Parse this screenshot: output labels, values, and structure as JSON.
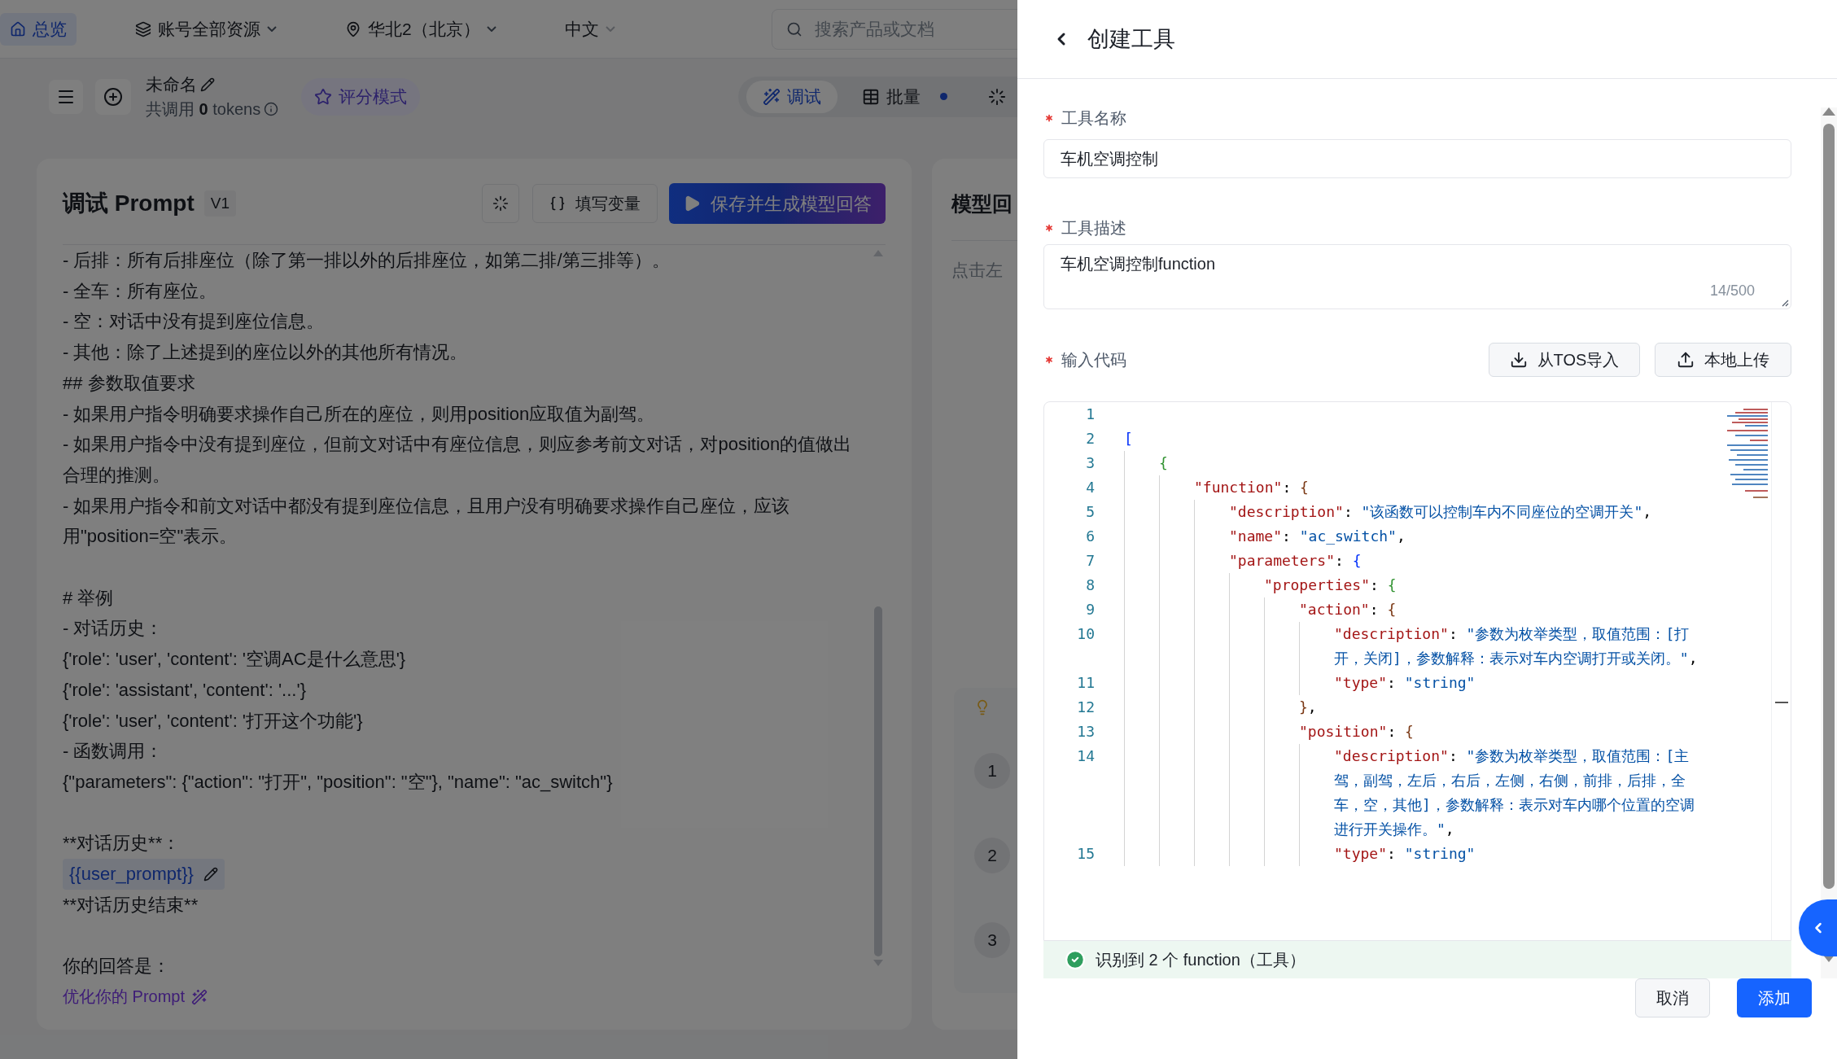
{
  "top_nav": {
    "items": [
      {
        "kind": "home",
        "label": "总览",
        "selected": true
      },
      {
        "kind": "layers",
        "label": "账号全部资源",
        "selected": false
      },
      {
        "kind": "location",
        "label": "华北2（北京）",
        "selected": false
      },
      {
        "kind": "language",
        "label": "中文",
        "selected": false
      }
    ],
    "search": {
      "placeholder": "搜索产品或文档"
    }
  },
  "toolbar": {
    "project_name": "未命名",
    "usage_label": "共调用",
    "usage_value": "0",
    "usage_unit": "tokens",
    "mode_button": "评分模式",
    "view_tabs": [
      {
        "kind": "debug",
        "label": "调试",
        "selected": true,
        "badge": false
      },
      {
        "kind": "batch",
        "label": "批量",
        "selected": false,
        "badge": true
      },
      {
        "kind": "sparkle",
        "selected": false,
        "badge": false
      }
    ]
  },
  "prompt_panel": {
    "title": "调试 Prompt",
    "version": "V1",
    "fill_variables_button": "填写变量",
    "run_button": "保存并生成模型回答",
    "lines": [
      {
        "kind": "text",
        "text": "- 后排：所有后排座位（除了第一排以外的后排座位，如第二排/第三排等）。"
      },
      {
        "kind": "text",
        "text": "- 全车：所有座位。"
      },
      {
        "kind": "text",
        "text": "- 空：对话中没有提到座位信息。"
      },
      {
        "kind": "text",
        "text": "- 其他：除了上述提到的座位以外的其他所有情况。"
      },
      {
        "kind": "text",
        "text": "## 参数取值要求"
      },
      {
        "kind": "text",
        "text": "- 如果用户指令明确要求操作自己所在的座位，则用position应取值为副驾。"
      },
      {
        "kind": "text",
        "text": "- 如果用户指令中没有提到座位，但前文对话中有座位信息，则应参考前文对话，对position的值做出合理的推测。"
      },
      {
        "kind": "text",
        "text": "- 如果用户指令和前文对话中都没有提到座位信息，且用户没有明确要求操作自己座位，应该用\"position=空\"表示。"
      },
      {
        "kind": "gap"
      },
      {
        "kind": "text",
        "text": "# 举例"
      },
      {
        "kind": "text",
        "text": "- 对话历史："
      },
      {
        "kind": "text",
        "text": "{'role': 'user', 'content': '空调AC是什么意思'}"
      },
      {
        "kind": "text",
        "text": "{'role': 'assistant', 'content': '...'}"
      },
      {
        "kind": "text",
        "text": "{'role': 'user', 'content': '打开这个功能'}"
      },
      {
        "kind": "text",
        "text": "- 函数调用："
      },
      {
        "kind": "text",
        "text": "{\"parameters\": {\"action\": \"打开\", \"position\": \"空\"}, \"name\": \"ac_switch\"}"
      },
      {
        "kind": "gap"
      },
      {
        "kind": "text",
        "text": "**对话历史**："
      },
      {
        "kind": "variable",
        "text": "{{user_prompt}}"
      },
      {
        "kind": "text",
        "text": "**对话历史结束**"
      },
      {
        "kind": "gap"
      },
      {
        "kind": "text",
        "text": "你的回答是："
      }
    ],
    "optimize_link": "优化你的 Prompt"
  },
  "result_panel": {
    "title": "模型回",
    "hint": "点击左",
    "steps": [
      "1",
      "2",
      "3"
    ]
  },
  "drawer": {
    "title": "创建工具",
    "name_field": {
      "label": "工具名称",
      "required": true,
      "value": "车机空调控制"
    },
    "description_field": {
      "label": "工具描述",
      "required": true,
      "value": "车机空调控制function",
      "counter": "14/500"
    },
    "code_field": {
      "label": "输入代码",
      "required": true,
      "buttons": [
        {
          "kind": "download",
          "label": "从TOS导入"
        },
        {
          "kind": "upload",
          "label": "本地上传"
        }
      ],
      "lines": [
        {
          "number": "1"
        },
        {
          "number": "2",
          "tokens": [
            {
              "kind": "bracket1",
              "text": "["
            }
          ]
        },
        {
          "number": "3",
          "tokens": [
            {
              "kind": "bracket2",
              "text": "    {"
            }
          ]
        },
        {
          "number": "4",
          "tokens": [
            {
              "kind": "key",
              "text": "        \"function\""
            },
            {
              "kind": "punct",
              "text": ": "
            },
            {
              "kind": "bracket3",
              "text": "{"
            }
          ]
        },
        {
          "number": "5",
          "tokens": [
            {
              "kind": "key",
              "text": "            \"description\""
            },
            {
              "kind": "punct",
              "text": ": "
            },
            {
              "kind": "string",
              "text": "\"该函数可以控制车内不同座位的空调开关\""
            },
            {
              "kind": "punct",
              "text": ","
            }
          ]
        },
        {
          "number": "6",
          "tokens": [
            {
              "kind": "key",
              "text": "            \"name\""
            },
            {
              "kind": "punct",
              "text": ": "
            },
            {
              "kind": "string",
              "text": "\"ac_switch\""
            },
            {
              "kind": "punct",
              "text": ","
            }
          ]
        },
        {
          "number": "7",
          "tokens": [
            {
              "kind": "key",
              "text": "            \"parameters\""
            },
            {
              "kind": "punct",
              "text": ": "
            },
            {
              "kind": "bracket1",
              "text": "{"
            }
          ]
        },
        {
          "number": "8",
          "tokens": [
            {
              "kind": "key",
              "text": "                \"properties\""
            },
            {
              "kind": "punct",
              "text": ": "
            },
            {
              "kind": "bracket2",
              "text": "{"
            }
          ]
        },
        {
          "number": "9",
          "tokens": [
            {
              "kind": "key",
              "text": "                    \"action\""
            },
            {
              "kind": "punct",
              "text": ": "
            },
            {
              "kind": "bracket3",
              "text": "{"
            }
          ]
        },
        {
          "number": "10",
          "tokens": [
            {
              "kind": "key",
              "text": "                        \"description\""
            },
            {
              "kind": "punct",
              "text": ": "
            },
            {
              "kind": "string",
              "text": "\"参数为枚举类型，取值范围：[打开，关闭]，参数解释：表示对车内空调打开或关闭。\""
            },
            {
              "kind": "punct",
              "text": ","
            }
          ]
        },
        {
          "number": "11",
          "tokens": [
            {
              "kind": "key",
              "text": "                        \"type\""
            },
            {
              "kind": "punct",
              "text": ": "
            },
            {
              "kind": "string",
              "text": "\"string\""
            }
          ]
        },
        {
          "number": "12",
          "tokens": [
            {
              "kind": "bracket3",
              "text": "                    }"
            },
            {
              "kind": "punct",
              "text": ","
            }
          ]
        },
        {
          "number": "13",
          "tokens": [
            {
              "kind": "key",
              "text": "                    \"position\""
            },
            {
              "kind": "punct",
              "text": ": "
            },
            {
              "kind": "bracket3",
              "text": "{"
            }
          ]
        },
        {
          "number": "14",
          "tokens": [
            {
              "kind": "key",
              "text": "                        \"description\""
            },
            {
              "kind": "punct",
              "text": ": "
            },
            {
              "kind": "string",
              "text": "\"参数为枚举类型，取值范围：[主驾，副驾，左后，右后，左侧，右侧，前排，后排，全车，空，其他]，参数解释：表示对车内哪个位置的空调进行开关操作。\""
            },
            {
              "kind": "punct",
              "text": ","
            }
          ]
        },
        {
          "number": "15",
          "tokens": [
            {
              "kind": "key",
              "text": "                        \"type\""
            },
            {
              "kind": "punct",
              "text": ": "
            },
            {
              "kind": "string",
              "text": "\"string\""
            }
          ]
        }
      ]
    },
    "status": {
      "kind": "success",
      "text": "识别到 2 个 function（工具）"
    },
    "buttons": [
      {
        "kind": "secondary",
        "label": "取消"
      },
      {
        "kind": "primary",
        "label": "添加"
      }
    ]
  }
}
